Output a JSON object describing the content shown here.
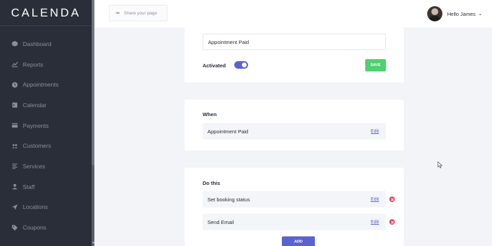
{
  "app": {
    "logo": "CALENDA"
  },
  "sidebar": {
    "items": [
      {
        "label": "Dashboard",
        "icon": "dashboard-icon"
      },
      {
        "label": "Reports",
        "icon": "reports-icon"
      },
      {
        "label": "Appointments",
        "icon": "appointments-icon"
      },
      {
        "label": "Calendar",
        "icon": "calendar-icon"
      },
      {
        "label": "Payments",
        "icon": "payments-icon"
      },
      {
        "label": "Customers",
        "icon": "customers-icon"
      },
      {
        "label": "Services",
        "icon": "services-icon"
      },
      {
        "label": "Staff",
        "icon": "staff-icon"
      },
      {
        "label": "Locations",
        "icon": "locations-icon"
      },
      {
        "label": "Coupons",
        "icon": "coupons-icon"
      }
    ]
  },
  "header": {
    "share_label": "Share your page",
    "user_greeting": "Hello James"
  },
  "automation": {
    "name_value": "Appointment Paid",
    "activated_label": "Activated",
    "activated": true,
    "save_label": "SAVE"
  },
  "when": {
    "title": "When",
    "trigger_label": "Appointment Paid",
    "edit_label": "Edit"
  },
  "do_this": {
    "title": "Do this",
    "actions": [
      {
        "label": "Set booking status",
        "edit_label": "Edit"
      },
      {
        "label": "Send Email",
        "edit_label": "Edit"
      }
    ],
    "add_label": "ADD"
  },
  "colors": {
    "sidebar_bg": "#2a2e38",
    "accent": "#5b63d3",
    "save": "#4fd170",
    "remove": "#e0455a"
  }
}
